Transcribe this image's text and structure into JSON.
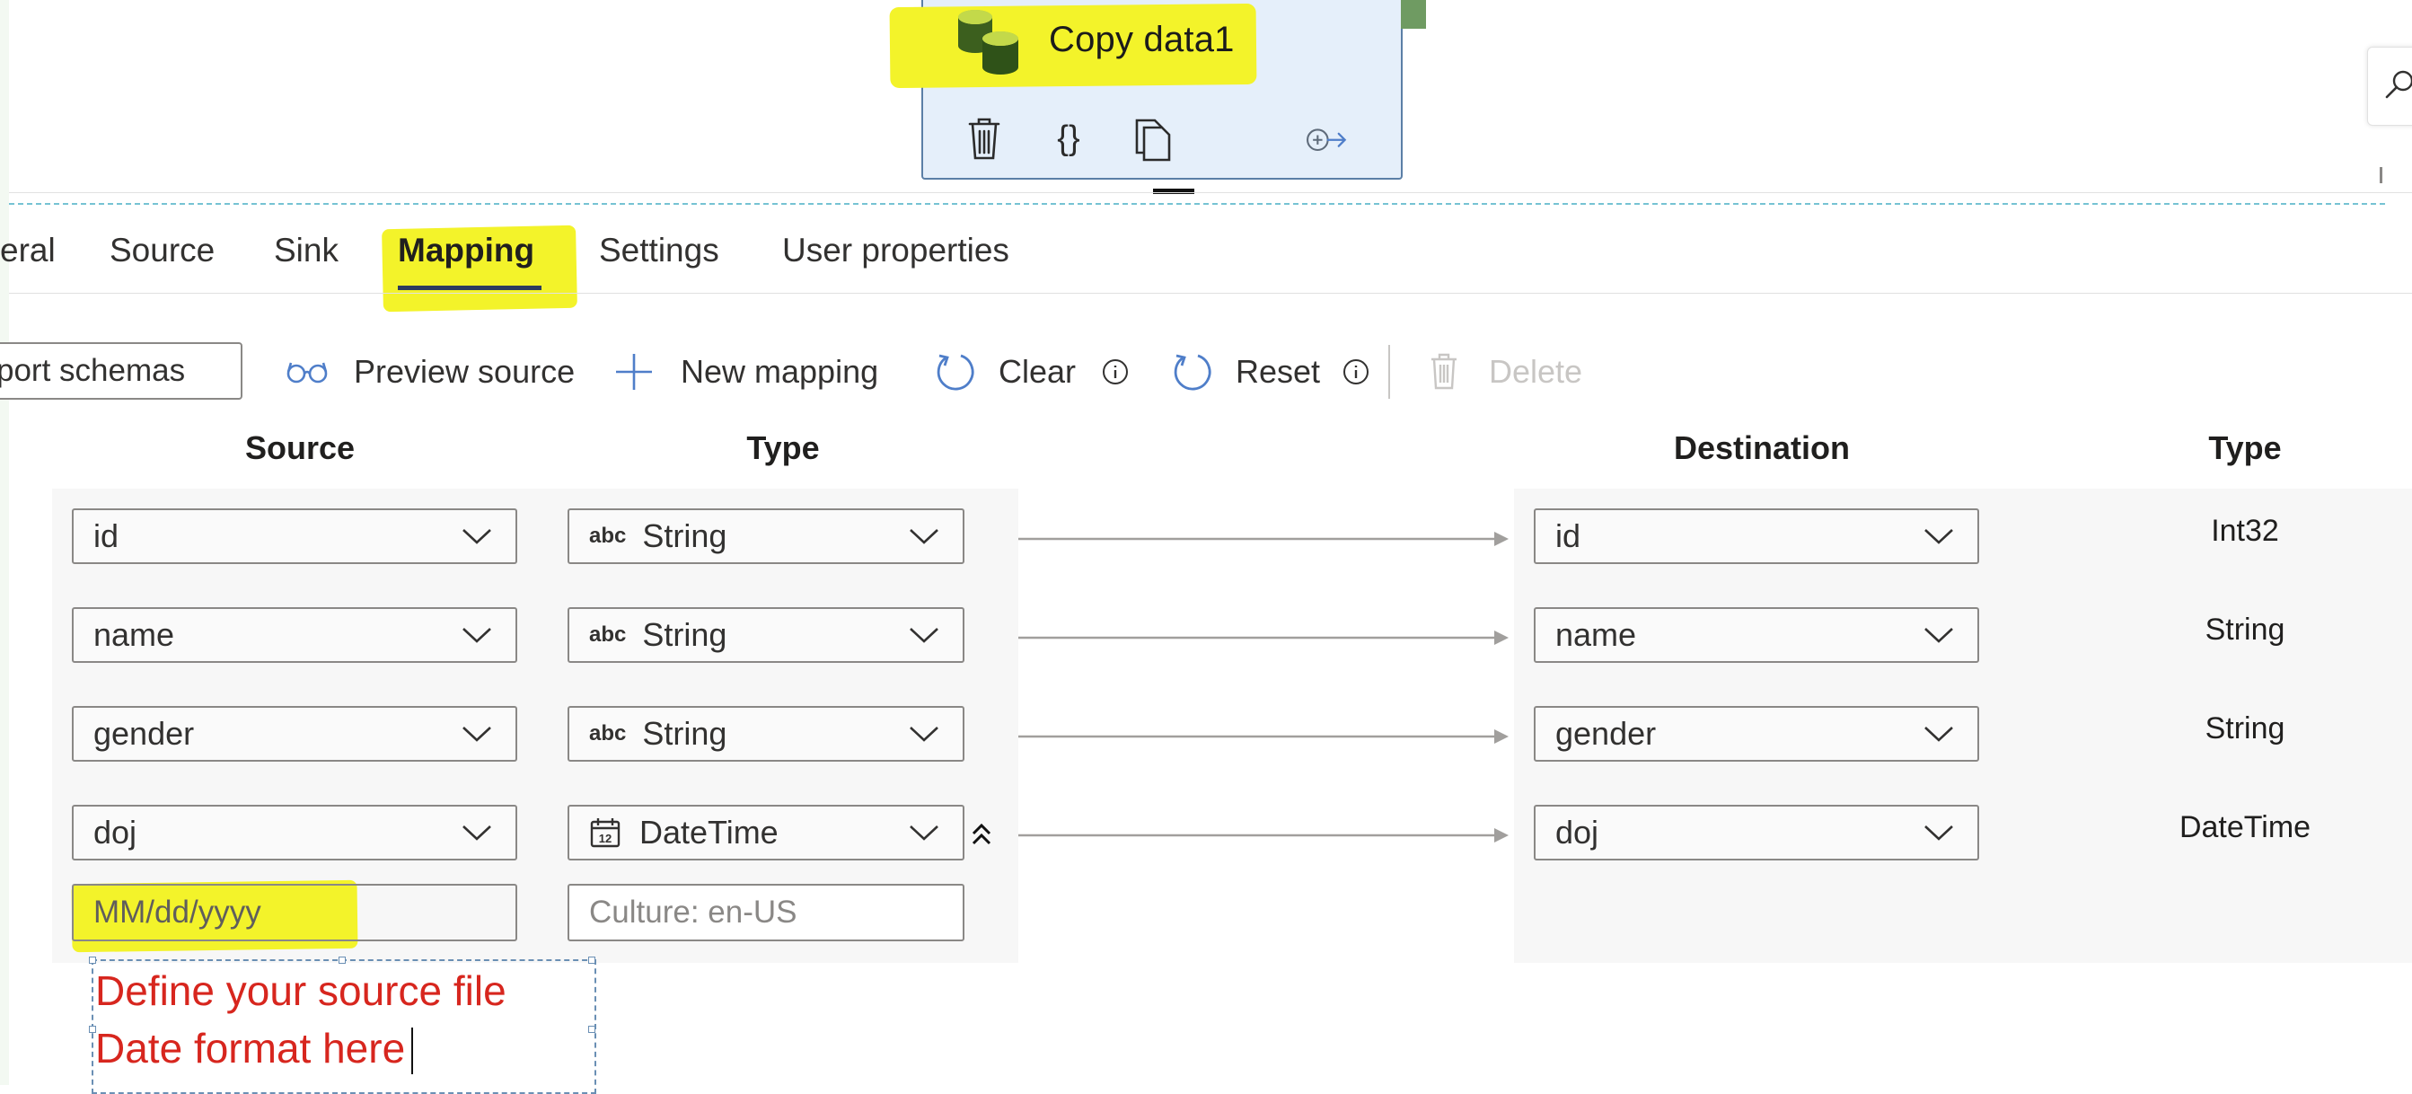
{
  "activity": {
    "title": "Copy data1",
    "icons": [
      "database-icon",
      "delete-icon",
      "code-icon",
      "copy-icon",
      "add-output-icon"
    ]
  },
  "tabs": [
    {
      "label": "eral",
      "active": false
    },
    {
      "label": "Source",
      "active": false
    },
    {
      "label": "Sink",
      "active": false
    },
    {
      "label": "Mapping",
      "active": true
    },
    {
      "label": "Settings",
      "active": false
    },
    {
      "label": "User properties",
      "active": false
    }
  ],
  "toolbar": {
    "import_schemas": "port schemas",
    "preview_source": "Preview source",
    "new_mapping": "New mapping",
    "clear": "Clear",
    "reset": "Reset",
    "delete": "Delete"
  },
  "columns": {
    "source": "Source",
    "type": "Type",
    "destination": "Destination",
    "dest_type": "Type"
  },
  "mappings": [
    {
      "source": "id",
      "type": "String",
      "destination": "id",
      "dest_type": "Int32"
    },
    {
      "source": "name",
      "type": "String",
      "destination": "name",
      "dest_type": "String"
    },
    {
      "source": "gender",
      "type": "String",
      "destination": "gender",
      "dest_type": "String"
    },
    {
      "source": "doj",
      "type": "DateTime",
      "destination": "doj",
      "dest_type": "DateTime"
    }
  ],
  "type_icon_text": "abc",
  "date_format": {
    "placeholder": "MM/dd/yyyy"
  },
  "culture": {
    "placeholder": "Culture: en-US"
  },
  "annotation": {
    "line1": "Define your source file",
    "line2": "Date format here"
  },
  "colors": {
    "highlight": "#f3f32a",
    "annotation_text": "#d7261e",
    "card_bg": "#e5effa",
    "accent_blue": "#4f7ec9"
  }
}
